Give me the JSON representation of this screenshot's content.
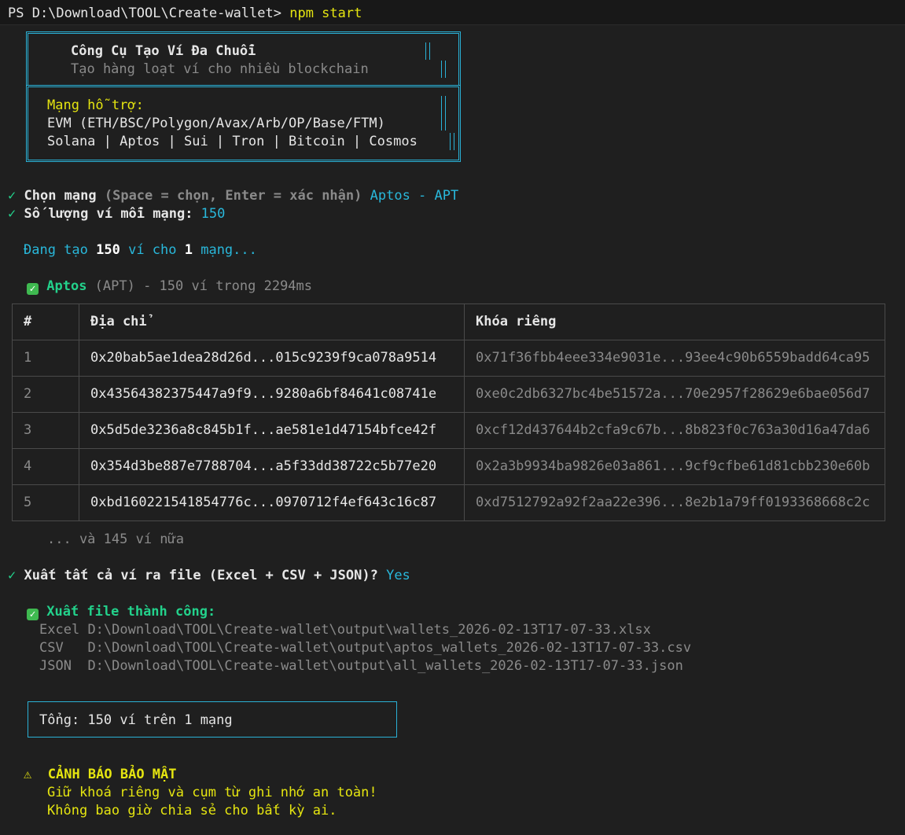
{
  "prompt": {
    "prefix": "PS D:\\Download\\TOOL\\Create-wallet> ",
    "command": "npm start"
  },
  "banner": {
    "title": "Công Cụ Tạo Ví Đa Chuỗi",
    "subtitle": "Tạo hàng loạt ví cho nhiều blockchain",
    "supported_label": "Mạng hỗ trợ:",
    "evm_line": "EVM (ETH/BSC/Polygon/Avax/Arb/OP/Base/FTM)",
    "other_line": "Solana | Aptos | Sui | Tron | Bitcoin | Cosmos"
  },
  "questions": {
    "select_network": {
      "check": "✓",
      "question": "Chọn mạng",
      "hint": " (Space = chọn, Enter = xác nhận) ",
      "answer": "Aptos - APT"
    },
    "wallet_count": {
      "check": "✓",
      "question": "Số lượng ví mỗi mạng: ",
      "answer": "150"
    }
  },
  "progress": {
    "prefix": "Đang tạo ",
    "count": "150",
    "middle": " ví cho ",
    "networks": "1",
    "suffix": " mạng..."
  },
  "result": {
    "icon": "✓",
    "network": "Aptos",
    "detail": " (APT) - 150 ví trong 2294ms"
  },
  "table": {
    "headers": [
      "#",
      "Địa chỉ",
      "Khóa riêng"
    ],
    "rows": [
      [
        "1",
        "0x20bab5ae1dea28d26d...015c9239f9ca078a9514",
        "0x71f36fbb4eee334e9031e...93ee4c90b6559badd64ca95"
      ],
      [
        "2",
        "0x43564382375447a9f9...9280a6bf84641c08741e",
        "0xe0c2db6327bc4be51572a...70e2957f28629e6bae056d7"
      ],
      [
        "3",
        "0x5d5de3236a8c845b1f...ae581e1d47154bfce42f",
        "0xcf12d437644b2cfa9c67b...8b823f0c763a30d16a47da6"
      ],
      [
        "4",
        "0x354d3be887e7788704...a5f33dd38722c5b77e20",
        "0x2a3b9934ba9826e03a861...9cf9cfbe61d81cbb230e60b"
      ],
      [
        "5",
        "0xbd160221541854776c...0970712f4ef643c16c87",
        "0xd7512792a92f2aa22e396...8e2b1a79ff0193368668c2c"
      ]
    ],
    "more": "... và 145 ví nữa"
  },
  "export": {
    "check": "✓",
    "question": "Xuất tất cả ví ra file (Excel + CSV + JSON)? ",
    "answer": "Yes",
    "success_icon": "✓",
    "success": "Xuất file thành công:",
    "files": [
      {
        "type": "Excel",
        "path": "D:\\Download\\TOOL\\Create-wallet\\output\\wallets_2026-02-13T17-07-33.xlsx"
      },
      {
        "type": "CSV  ",
        "path": "D:\\Download\\TOOL\\Create-wallet\\output\\aptos_wallets_2026-02-13T17-07-33.csv"
      },
      {
        "type": "JSON ",
        "path": "D:\\Download\\TOOL\\Create-wallet\\output\\all_wallets_2026-02-13T17-07-33.json"
      }
    ]
  },
  "summary": {
    "total": "Tổng: 150 ví trên 1 mạng"
  },
  "warning": {
    "icon": "⚠",
    "title": "CẢNH BÁO BẢO MẬT",
    "line1": "Giữ khoá riêng và cụm từ ghi nhớ an toàn!",
    "line2": "Không bao giờ chia sẻ cho bất kỳ ai."
  },
  "colors": {
    "background": "#1f1f1f",
    "accent_cyan": "#29b8db",
    "yellow": "#e5e510",
    "green": "#23d18b"
  }
}
